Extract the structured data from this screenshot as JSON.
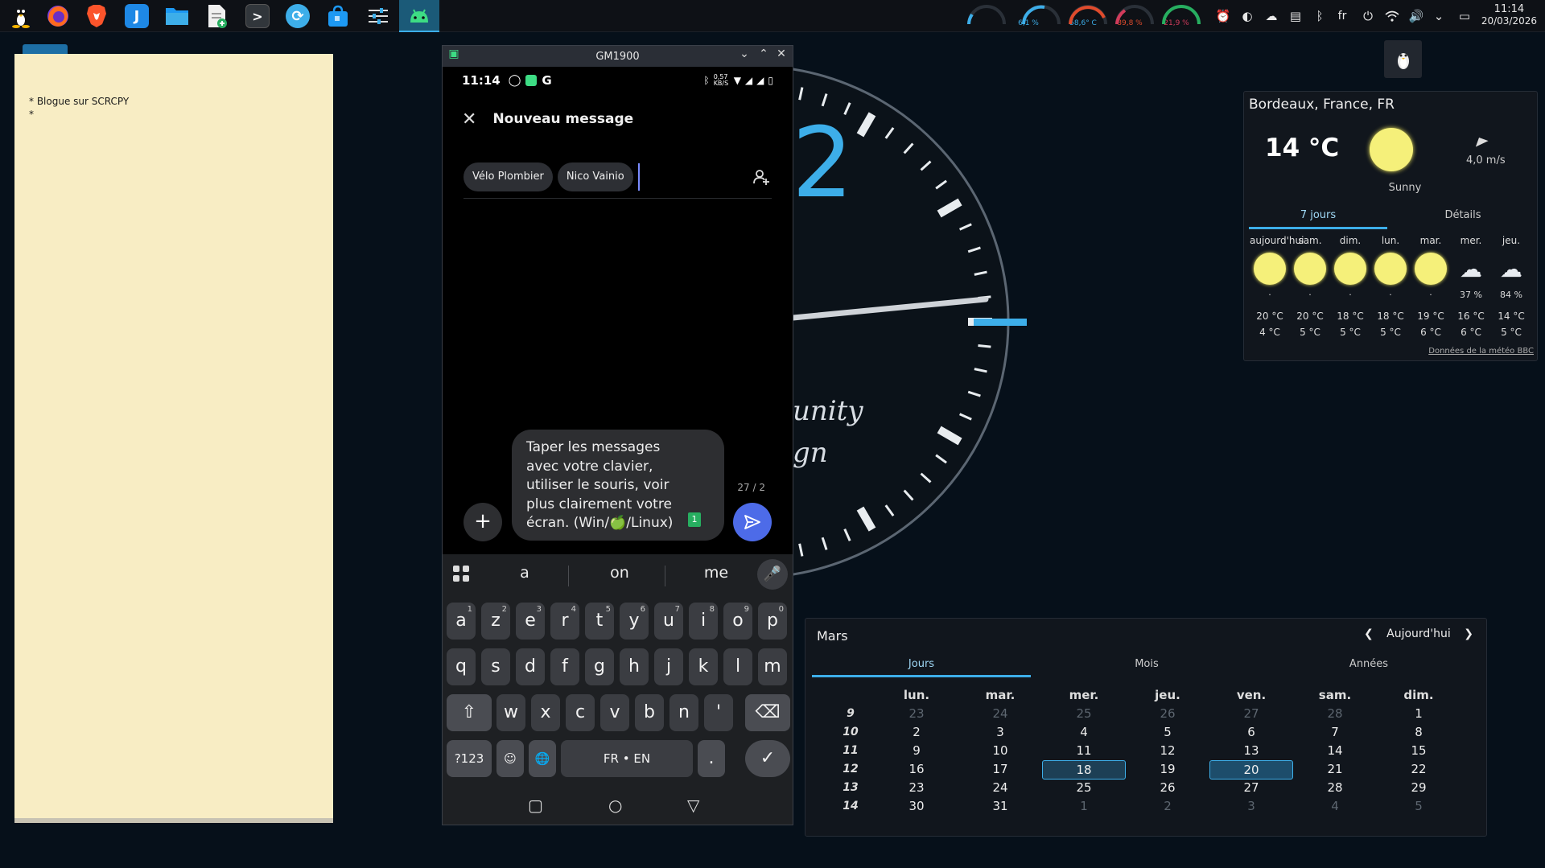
{
  "taskbar": {
    "launchers": [
      "tux-icon",
      "firefox-icon",
      "brave-icon",
      "jdownloader-icon",
      "file-manager-icon",
      "document-new-icon",
      "terminal-icon",
      "sync-icon",
      "software-store-icon",
      "settings-icon",
      "scrcpy-icon"
    ],
    "gauges": [
      {
        "label": "6,1 %",
        "color": "#3daee9"
      },
      {
        "label": "58,6° C",
        "color": "#3daee9"
      },
      {
        "label": "89,8 %",
        "color": "#e04b2c"
      },
      {
        "label": "21,9 %",
        "color": "#d13b5b"
      },
      {
        "label": "",
        "color": "#27ae60"
      }
    ],
    "tray": {
      "lang": "fr"
    },
    "clock": {
      "time": "11:14",
      "date": "20/03/2026"
    }
  },
  "note": {
    "lines": [
      "* Blogue sur SCRCPY",
      "*"
    ]
  },
  "phone": {
    "window_title": "GM1900",
    "status_time": "11:14",
    "status_speed": "0,57 KB/S",
    "header_title": "Nouveau message",
    "recipients": [
      "Vélo Plombier",
      "Nico Vainio"
    ],
    "compose_text": "Taper les messages avec votre clavier, utiliser le souris, voir plus clairement votre écran. (Win/🍏/Linux)",
    "compose_lines": [
      "Taper les messages",
      "avec votre clavier,",
      "utiliser le souris, voir",
      "plus clairement votre",
      "écran. (Win/🍏/Linux)"
    ],
    "counter": "27 / 2",
    "sim": "1",
    "suggestions": [
      "a",
      "on",
      "me"
    ],
    "keyboard": {
      "row1": [
        [
          "a",
          "1"
        ],
        [
          "z",
          "2"
        ],
        [
          "e",
          "3"
        ],
        [
          "r",
          "4"
        ],
        [
          "t",
          "5"
        ],
        [
          "y",
          "6"
        ],
        [
          "u",
          "7"
        ],
        [
          "i",
          "8"
        ],
        [
          "o",
          "9"
        ],
        [
          "p",
          "0"
        ]
      ],
      "row2": [
        "q",
        "s",
        "d",
        "f",
        "g",
        "h",
        "j",
        "k",
        "l",
        "m"
      ],
      "row3": [
        "w",
        "x",
        "c",
        "v",
        "b",
        "n",
        "'"
      ],
      "sym_label": "?123",
      "space_label": "FR • EN",
      "period": "."
    }
  },
  "weather": {
    "location": "Bordeaux, France, FR",
    "temp": "14 °C",
    "condition": "Sunny",
    "wind": "4,0 m/s",
    "tabs": [
      "7 jours",
      "Détails"
    ],
    "days": [
      {
        "name": "aujourd'hui",
        "icon": "sun",
        "precip": "·",
        "hi": "20 °C",
        "lo": "4 °C"
      },
      {
        "name": "sam.",
        "icon": "sun",
        "precip": "·",
        "hi": "20 °C",
        "lo": "5 °C"
      },
      {
        "name": "dim.",
        "icon": "sun",
        "precip": "·",
        "hi": "18 °C",
        "lo": "5 °C"
      },
      {
        "name": "lun.",
        "icon": "sun",
        "precip": "·",
        "hi": "18 °C",
        "lo": "5 °C"
      },
      {
        "name": "mar.",
        "icon": "sun",
        "precip": "·",
        "hi": "19 °C",
        "lo": "6 °C"
      },
      {
        "name": "mer.",
        "icon": "snow-cloud",
        "precip": "37 %",
        "hi": "16 °C",
        "lo": "6 °C"
      },
      {
        "name": "jeu.",
        "icon": "snow-cloud",
        "precip": "84 %",
        "hi": "14 °C",
        "lo": "5 °C"
      }
    ],
    "source": "Données de la météo BBC"
  },
  "calendar": {
    "month": "Mars",
    "today_label": "Aujourd'hui",
    "tabs": [
      "Jours",
      "Mois",
      "Années"
    ],
    "weekdays": [
      "lun.",
      "mar.",
      "mer.",
      "jeu.",
      "ven.",
      "sam.",
      "dim."
    ],
    "weeks": [
      {
        "num": "9",
        "days": [
          "23",
          "24",
          "25",
          "26",
          "27",
          "28",
          "1"
        ],
        "faded": [
          true,
          true,
          true,
          true,
          true,
          true,
          false
        ]
      },
      {
        "num": "10",
        "days": [
          "2",
          "3",
          "4",
          "5",
          "6",
          "7",
          "8"
        ],
        "faded": [
          false,
          false,
          false,
          false,
          false,
          false,
          false
        ]
      },
      {
        "num": "11",
        "days": [
          "9",
          "10",
          "11",
          "12",
          "13",
          "14",
          "15"
        ],
        "faded": [
          false,
          false,
          false,
          false,
          false,
          false,
          false
        ]
      },
      {
        "num": "12",
        "days": [
          "16",
          "17",
          "18",
          "19",
          "20",
          "21",
          "22"
        ],
        "faded": [
          false,
          false,
          false,
          false,
          false,
          false,
          false
        ]
      },
      {
        "num": "13",
        "days": [
          "23",
          "24",
          "25",
          "26",
          "27",
          "28",
          "29"
        ],
        "faded": [
          false,
          false,
          false,
          false,
          false,
          false,
          false
        ]
      },
      {
        "num": "14",
        "days": [
          "30",
          "31",
          "1",
          "2",
          "3",
          "4",
          "5"
        ],
        "faded": [
          false,
          false,
          true,
          true,
          true,
          true,
          true
        ]
      }
    ],
    "highlight": "18",
    "today": "20"
  },
  "clock_widget": {
    "fragment_digit": "2",
    "fragment_text": [
      "unity",
      "gn"
    ]
  }
}
